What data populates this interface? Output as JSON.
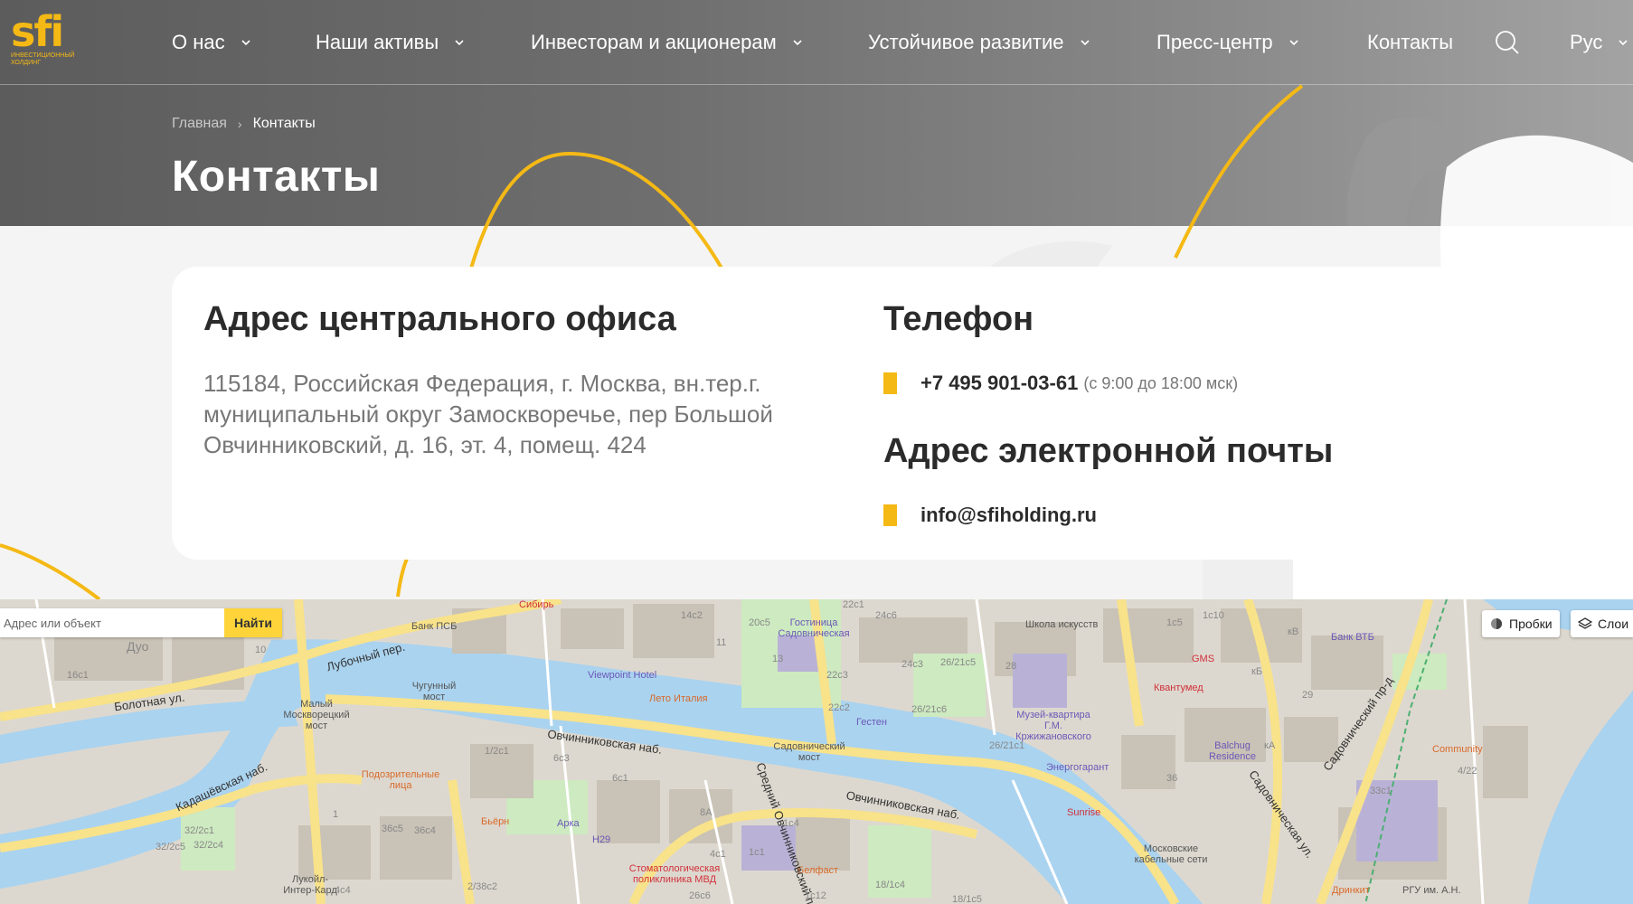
{
  "logo": {
    "mark": "sfi",
    "subtitle": "инвестиционный холдинг"
  },
  "nav": {
    "items": [
      {
        "label": "О нас",
        "has_dropdown": true
      },
      {
        "label": "Наши активы",
        "has_dropdown": true
      },
      {
        "label": "Инвесторам и акционерам",
        "has_dropdown": true
      },
      {
        "label": "Устойчивое развитие",
        "has_dropdown": true
      },
      {
        "label": "Пресс-центр",
        "has_dropdown": true
      },
      {
        "label": "Контакты",
        "has_dropdown": false
      },
      {
        "label": "Рус",
        "has_dropdown": true
      }
    ],
    "search_icon": "search-icon"
  },
  "breadcrumb": {
    "home": "Главная",
    "current": "Контакты"
  },
  "page_title": "Контакты",
  "address": {
    "title": "Адрес центрального офиса",
    "text": "115184, Российская Федерация, г. Москва, вн.тер.г. муниципальный округ Замоскворечье, пер Большой Овчинниковский, д. 16, эт. 4, помещ. 424"
  },
  "phone": {
    "title": "Телефон",
    "number": "+7 495 901-03-61",
    "hours": "(с 9:00 до 18:00 мск)"
  },
  "email": {
    "title": "Адрес электронной почты",
    "address": "info@sfiholding.ru"
  },
  "colors": {
    "accent": "#f5b915",
    "header_bg": "#6e6e6e",
    "river": "#aad3ef",
    "park": "#cdeac0"
  },
  "map": {
    "search_placeholder": "Адрес или объект",
    "search_button": "Найти",
    "traffic_button": "Пробки",
    "layers_button": "Слои",
    "labels": {
      "sibir": "Сибирь",
      "bank_psb": "Банк ПСБ",
      "lubochny": "Лубочный пер.",
      "bolotnaya": "Болотная ул.",
      "maly_most": "Малый Москворецкий мост",
      "chugunny": "Чугунный мост",
      "viewpoint": "Viewpoint Hotel",
      "leto": "Лето Италия",
      "sadovnicheskaya_hotel": "Гостиница Садовническая",
      "school": "Школа искусств",
      "gesten": "Гестен",
      "ovch_nab_1": "Овчинниковская наб.",
      "ovch_nab_2": "Овчинниковская наб.",
      "sad_most": "Садовнический мост",
      "museum": "Музей-квартира Г.М. Кржижановского",
      "energogarant": "Энергогарант",
      "sunrise": "Sunrise",
      "kvantumed": "Квантумед",
      "gms": "GMS",
      "balchug": "Balchug Residence",
      "bank_vtb": "Банк ВТБ",
      "community": "Community",
      "sad_pr": "Садовнический пр-д",
      "sad_ul": "Садовническая ул.",
      "kadashevskaya": "Кадашёвская наб.",
      "podozr": "Подозрительные лица",
      "bern": "Бьёрн",
      "arka": "Арка",
      "h29": "H29",
      "stomat": "Стоматологическая поликлиника МВД",
      "belfast": "Белфаст",
      "cable": "Московские кабельные сети",
      "drinkit": "Дринкит",
      "rgu": "РГУ им. А.Н.",
      "lukoil": "Лукойл-Интер-Кард",
      "sr_ovch": "Средний Овчинниковский пер.",
      "duo": "Дуо"
    },
    "buildings": [
      "14с2",
      "20с5",
      "22с1",
      "24с6",
      "1с5",
      "1с10",
      "10",
      "16с1",
      "11",
      "13",
      "22с3",
      "24с3",
      "26/21с5",
      "28",
      "кВ",
      "кБ",
      "29",
      "22с2",
      "26/21с6",
      "26/21с1",
      "36",
      "кА",
      "1/2с1",
      "6с3",
      "6с1",
      "8А",
      "4с1",
      "1с4",
      "1с1",
      "33с1",
      "4/22",
      "32/2с1",
      "32/2с4",
      "36с5",
      "36с4",
      "32/2с5",
      "4с4",
      "2/38с2",
      "26с6",
      "1с12",
      "18/1с5",
      "18/1с4",
      "1"
    ]
  }
}
